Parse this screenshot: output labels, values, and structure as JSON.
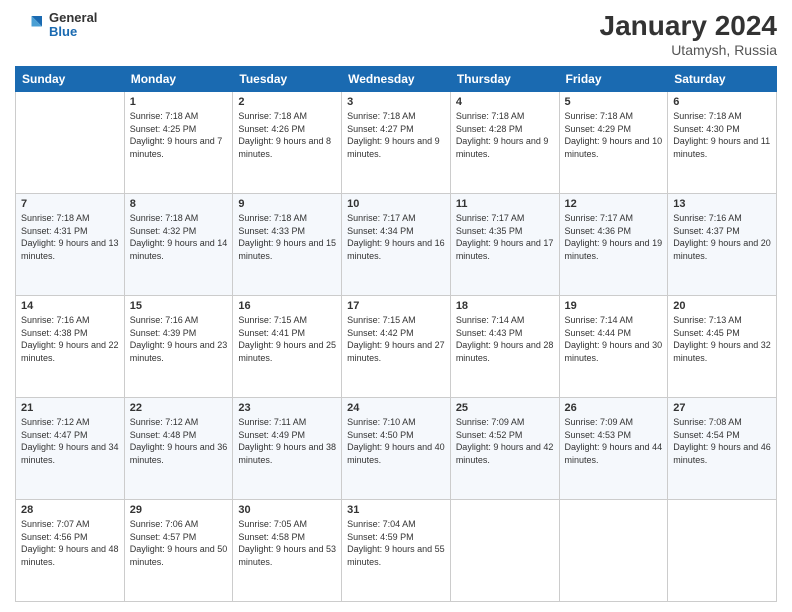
{
  "header": {
    "logo": {
      "general": "General",
      "blue": "Blue"
    },
    "title": "January 2024",
    "location": "Utamysh, Russia"
  },
  "days_of_week": [
    "Sunday",
    "Monday",
    "Tuesday",
    "Wednesday",
    "Thursday",
    "Friday",
    "Saturday"
  ],
  "weeks": [
    [
      {
        "day": "",
        "sunrise": "",
        "sunset": "",
        "daylight": ""
      },
      {
        "day": "1",
        "sunrise": "Sunrise: 7:18 AM",
        "sunset": "Sunset: 4:25 PM",
        "daylight": "Daylight: 9 hours and 7 minutes."
      },
      {
        "day": "2",
        "sunrise": "Sunrise: 7:18 AM",
        "sunset": "Sunset: 4:26 PM",
        "daylight": "Daylight: 9 hours and 8 minutes."
      },
      {
        "day": "3",
        "sunrise": "Sunrise: 7:18 AM",
        "sunset": "Sunset: 4:27 PM",
        "daylight": "Daylight: 9 hours and 9 minutes."
      },
      {
        "day": "4",
        "sunrise": "Sunrise: 7:18 AM",
        "sunset": "Sunset: 4:28 PM",
        "daylight": "Daylight: 9 hours and 9 minutes."
      },
      {
        "day": "5",
        "sunrise": "Sunrise: 7:18 AM",
        "sunset": "Sunset: 4:29 PM",
        "daylight": "Daylight: 9 hours and 10 minutes."
      },
      {
        "day": "6",
        "sunrise": "Sunrise: 7:18 AM",
        "sunset": "Sunset: 4:30 PM",
        "daylight": "Daylight: 9 hours and 11 minutes."
      }
    ],
    [
      {
        "day": "7",
        "sunrise": "Sunrise: 7:18 AM",
        "sunset": "Sunset: 4:31 PM",
        "daylight": "Daylight: 9 hours and 13 minutes."
      },
      {
        "day": "8",
        "sunrise": "Sunrise: 7:18 AM",
        "sunset": "Sunset: 4:32 PM",
        "daylight": "Daylight: 9 hours and 14 minutes."
      },
      {
        "day": "9",
        "sunrise": "Sunrise: 7:18 AM",
        "sunset": "Sunset: 4:33 PM",
        "daylight": "Daylight: 9 hours and 15 minutes."
      },
      {
        "day": "10",
        "sunrise": "Sunrise: 7:17 AM",
        "sunset": "Sunset: 4:34 PM",
        "daylight": "Daylight: 9 hours and 16 minutes."
      },
      {
        "day": "11",
        "sunrise": "Sunrise: 7:17 AM",
        "sunset": "Sunset: 4:35 PM",
        "daylight": "Daylight: 9 hours and 17 minutes."
      },
      {
        "day": "12",
        "sunrise": "Sunrise: 7:17 AM",
        "sunset": "Sunset: 4:36 PM",
        "daylight": "Daylight: 9 hours and 19 minutes."
      },
      {
        "day": "13",
        "sunrise": "Sunrise: 7:16 AM",
        "sunset": "Sunset: 4:37 PM",
        "daylight": "Daylight: 9 hours and 20 minutes."
      }
    ],
    [
      {
        "day": "14",
        "sunrise": "Sunrise: 7:16 AM",
        "sunset": "Sunset: 4:38 PM",
        "daylight": "Daylight: 9 hours and 22 minutes."
      },
      {
        "day": "15",
        "sunrise": "Sunrise: 7:16 AM",
        "sunset": "Sunset: 4:39 PM",
        "daylight": "Daylight: 9 hours and 23 minutes."
      },
      {
        "day": "16",
        "sunrise": "Sunrise: 7:15 AM",
        "sunset": "Sunset: 4:41 PM",
        "daylight": "Daylight: 9 hours and 25 minutes."
      },
      {
        "day": "17",
        "sunrise": "Sunrise: 7:15 AM",
        "sunset": "Sunset: 4:42 PM",
        "daylight": "Daylight: 9 hours and 27 minutes."
      },
      {
        "day": "18",
        "sunrise": "Sunrise: 7:14 AM",
        "sunset": "Sunset: 4:43 PM",
        "daylight": "Daylight: 9 hours and 28 minutes."
      },
      {
        "day": "19",
        "sunrise": "Sunrise: 7:14 AM",
        "sunset": "Sunset: 4:44 PM",
        "daylight": "Daylight: 9 hours and 30 minutes."
      },
      {
        "day": "20",
        "sunrise": "Sunrise: 7:13 AM",
        "sunset": "Sunset: 4:45 PM",
        "daylight": "Daylight: 9 hours and 32 minutes."
      }
    ],
    [
      {
        "day": "21",
        "sunrise": "Sunrise: 7:12 AM",
        "sunset": "Sunset: 4:47 PM",
        "daylight": "Daylight: 9 hours and 34 minutes."
      },
      {
        "day": "22",
        "sunrise": "Sunrise: 7:12 AM",
        "sunset": "Sunset: 4:48 PM",
        "daylight": "Daylight: 9 hours and 36 minutes."
      },
      {
        "day": "23",
        "sunrise": "Sunrise: 7:11 AM",
        "sunset": "Sunset: 4:49 PM",
        "daylight": "Daylight: 9 hours and 38 minutes."
      },
      {
        "day": "24",
        "sunrise": "Sunrise: 7:10 AM",
        "sunset": "Sunset: 4:50 PM",
        "daylight": "Daylight: 9 hours and 40 minutes."
      },
      {
        "day": "25",
        "sunrise": "Sunrise: 7:09 AM",
        "sunset": "Sunset: 4:52 PM",
        "daylight": "Daylight: 9 hours and 42 minutes."
      },
      {
        "day": "26",
        "sunrise": "Sunrise: 7:09 AM",
        "sunset": "Sunset: 4:53 PM",
        "daylight": "Daylight: 9 hours and 44 minutes."
      },
      {
        "day": "27",
        "sunrise": "Sunrise: 7:08 AM",
        "sunset": "Sunset: 4:54 PM",
        "daylight": "Daylight: 9 hours and 46 minutes."
      }
    ],
    [
      {
        "day": "28",
        "sunrise": "Sunrise: 7:07 AM",
        "sunset": "Sunset: 4:56 PM",
        "daylight": "Daylight: 9 hours and 48 minutes."
      },
      {
        "day": "29",
        "sunrise": "Sunrise: 7:06 AM",
        "sunset": "Sunset: 4:57 PM",
        "daylight": "Daylight: 9 hours and 50 minutes."
      },
      {
        "day": "30",
        "sunrise": "Sunrise: 7:05 AM",
        "sunset": "Sunset: 4:58 PM",
        "daylight": "Daylight: 9 hours and 53 minutes."
      },
      {
        "day": "31",
        "sunrise": "Sunrise: 7:04 AM",
        "sunset": "Sunset: 4:59 PM",
        "daylight": "Daylight: 9 hours and 55 minutes."
      },
      {
        "day": "",
        "sunrise": "",
        "sunset": "",
        "daylight": ""
      },
      {
        "day": "",
        "sunrise": "",
        "sunset": "",
        "daylight": ""
      },
      {
        "day": "",
        "sunrise": "",
        "sunset": "",
        "daylight": ""
      }
    ]
  ]
}
